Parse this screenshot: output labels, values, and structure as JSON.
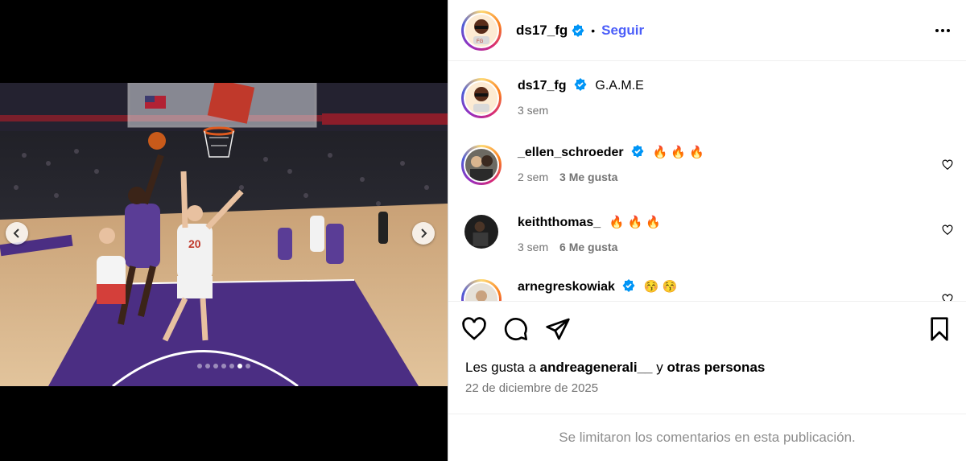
{
  "media": {
    "photo_alt": "basketball-photo",
    "total_slides": 7,
    "active_slide": 6,
    "prev_label": "‹",
    "next_label": "›"
  },
  "post_header": {
    "username": "ds17_fg",
    "separator": "•",
    "follow_label": "Seguir"
  },
  "caption": {
    "username": "ds17_fg",
    "text": "G.A.M.E",
    "time": "3 sem"
  },
  "comments": [
    {
      "username": "_ellen_schroeder",
      "verified": true,
      "text": "🔥 🔥 🔥",
      "time": "2 sem",
      "likes": "3 Me gusta"
    },
    {
      "username": "keiththomas_",
      "verified": false,
      "text": "🔥 🔥 🔥",
      "time": "3 sem",
      "likes": "6 Me gusta"
    },
    {
      "username": "arnegreskowiak",
      "verified": true,
      "text": "😚 😚",
      "time": "",
      "likes": ""
    }
  ],
  "likes": {
    "prefix": "Les gusta a",
    "user": "andreagenerali__",
    "conj": "y",
    "others": "otras personas"
  },
  "date": "22 de diciembre de 2025",
  "footer": "Se limitaron los comentarios en esta publicación.",
  "colors": {
    "follow": "#4a5df9",
    "verified": "#0095f6",
    "meta": "#737373",
    "court_purple": "#4b2e83"
  },
  "icons": [
    "heart-icon",
    "comment-icon",
    "share-icon",
    "bookmark-icon",
    "more-icon",
    "verified-icon",
    "chevron-left-icon",
    "chevron-right-icon"
  ]
}
